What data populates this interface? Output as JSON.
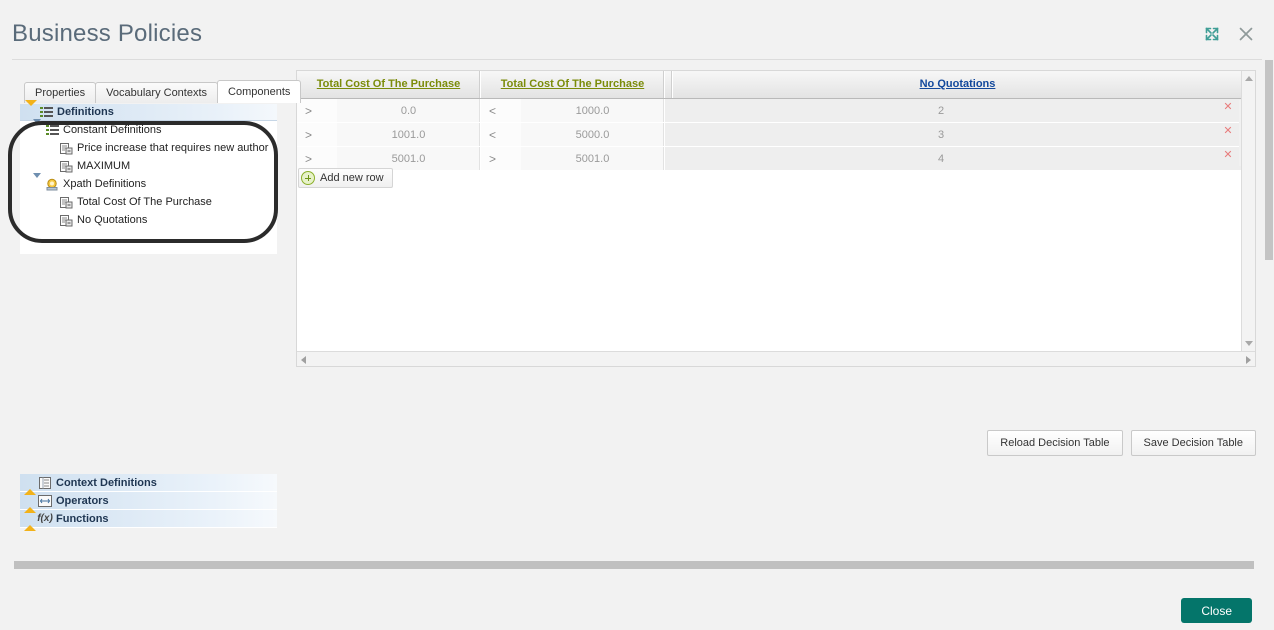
{
  "window": {
    "title": "Business Policies",
    "expand_icon": "expand-icon",
    "close_icon": "close-icon"
  },
  "tabs": [
    {
      "label": "Properties",
      "active": false
    },
    {
      "label": "Vocabulary Contexts",
      "active": false
    },
    {
      "label": "Components",
      "active": true
    }
  ],
  "tree": {
    "root_label": "Definitions",
    "groups": [
      {
        "label": "Constant Definitions",
        "icon": "list-icon",
        "children": [
          {
            "label": "Price increase that requires new author",
            "icon": "definition-icon"
          },
          {
            "label": "MAXIMUM",
            "icon": "definition-icon"
          }
        ]
      },
      {
        "label": "Xpath Definitions",
        "icon": "xpath-icon",
        "children": [
          {
            "label": "Total Cost Of The Purchase",
            "icon": "definition-icon"
          },
          {
            "label": "No Quotations",
            "icon": "definition-icon"
          }
        ]
      }
    ]
  },
  "sections": [
    {
      "label": "Context Definitions",
      "icon": "context-icon"
    },
    {
      "label": "Operators",
      "icon": "operator-icon"
    },
    {
      "label": "Functions",
      "icon": "function-icon"
    }
  ],
  "decision_table": {
    "columns": [
      {
        "label": "Total Cost Of The Purchase",
        "kind": "condition"
      },
      {
        "label": "Total Cost Of The Purchase",
        "kind": "condition"
      },
      {
        "label": "No Quotations",
        "kind": "action"
      }
    ],
    "rows": [
      {
        "c1_op": ">",
        "c1_val": "0.0",
        "c2_op": "<",
        "c2_val": "1000.0",
        "action": "2",
        "delete_icon": "delete-row-icon"
      },
      {
        "c1_op": ">",
        "c1_val": "1001.0",
        "c2_op": "<",
        "c2_val": "5000.0",
        "action": "3",
        "delete_icon": "delete-row-icon"
      },
      {
        "c1_op": ">",
        "c1_val": "5001.0",
        "c2_op": ">",
        "c2_val": "5001.0",
        "action": "4",
        "delete_icon": "delete-row-icon"
      }
    ],
    "add_row_label": "Add new row",
    "add_row_icon": "plus-circle-icon"
  },
  "buttons": {
    "reload": "Reload Decision Table",
    "save": "Save Decision Table",
    "close": "Close"
  },
  "colors": {
    "condition_header": "#7b8c0a",
    "action_header": "#12489c",
    "close_button": "#04756a",
    "accent_teal": "#3f9e96",
    "annotation": "#2b2b2b"
  }
}
